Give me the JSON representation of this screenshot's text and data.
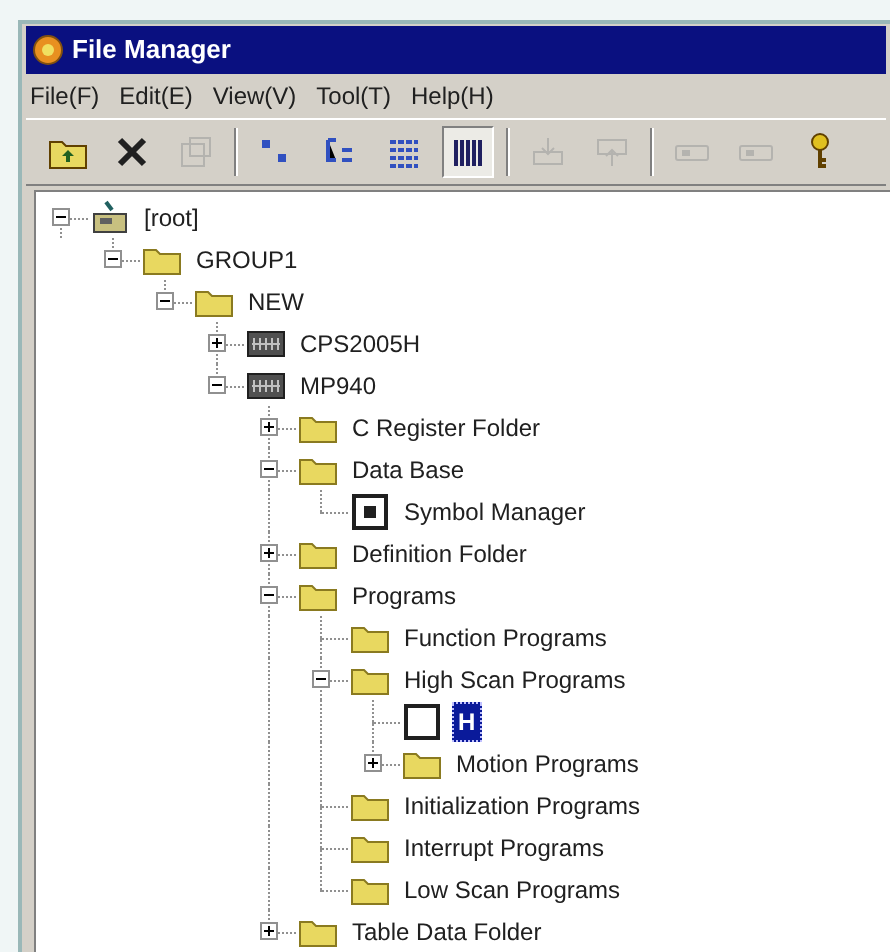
{
  "window": {
    "title": "File Manager"
  },
  "menu": [
    "File(F)",
    "Edit(E)",
    "View(V)",
    "Tool(T)",
    "Help(H)"
  ],
  "toolbar": [
    {
      "kind": "up-folder",
      "pressed": false,
      "disabled": false
    },
    {
      "kind": "delete",
      "pressed": false,
      "disabled": false
    },
    {
      "kind": "properties",
      "pressed": false,
      "disabled": true
    },
    {
      "kind": "sep"
    },
    {
      "kind": "large-icons",
      "pressed": false,
      "disabled": false
    },
    {
      "kind": "small-icons",
      "pressed": false,
      "disabled": false
    },
    {
      "kind": "list",
      "pressed": false,
      "disabled": false
    },
    {
      "kind": "details",
      "pressed": true,
      "disabled": false
    },
    {
      "kind": "sep"
    },
    {
      "kind": "import",
      "pressed": false,
      "disabled": true
    },
    {
      "kind": "export",
      "pressed": false,
      "disabled": true
    },
    {
      "kind": "sep"
    },
    {
      "kind": "device",
      "pressed": false,
      "disabled": true
    },
    {
      "kind": "device",
      "pressed": false,
      "disabled": true
    },
    {
      "kind": "key",
      "pressed": false,
      "disabled": false
    }
  ],
  "tree": [
    {
      "label": "[root]",
      "kind": "root",
      "expanded": true,
      "selected": false,
      "children": [
        {
          "label": "GROUP1",
          "kind": "folder",
          "expanded": true,
          "selected": false,
          "children": [
            {
              "label": "NEW",
              "kind": "folder",
              "expanded": true,
              "selected": false,
              "children": [
                {
                  "label": "CPS2005H",
                  "kind": "cpu",
                  "expanded": false,
                  "selected": false
                },
                {
                  "label": "MP940",
                  "kind": "cpu",
                  "expanded": true,
                  "selected": false,
                  "children": [
                    {
                      "label": "C Register Folder",
                      "kind": "folder",
                      "expanded": false,
                      "selected": false
                    },
                    {
                      "label": "Data Base",
                      "kind": "folder",
                      "expanded": true,
                      "selected": false,
                      "children": [
                        {
                          "label": "Symbol Manager",
                          "kind": "symbol",
                          "selected": false
                        }
                      ]
                    },
                    {
                      "label": "Definition Folder",
                      "kind": "folder",
                      "expanded": false,
                      "selected": false
                    },
                    {
                      "label": "Programs",
                      "kind": "folder",
                      "expanded": true,
                      "selected": false,
                      "children": [
                        {
                          "label": "Function Programs",
                          "kind": "folder",
                          "selected": false
                        },
                        {
                          "label": "High Scan Programs",
                          "kind": "folder",
                          "expanded": true,
                          "selected": false,
                          "children": [
                            {
                              "label": "H",
                              "kind": "blank",
                              "selected": true
                            },
                            {
                              "label": "Motion Programs",
                              "kind": "folder",
                              "expanded": false,
                              "selected": false
                            }
                          ]
                        },
                        {
                          "label": "Initialization Programs",
                          "kind": "folder",
                          "selected": false
                        },
                        {
                          "label": "Interrupt Programs",
                          "kind": "folder",
                          "selected": false
                        },
                        {
                          "label": "Low Scan Programs",
                          "kind": "folder",
                          "selected": false
                        }
                      ]
                    },
                    {
                      "label": "Table Data Folder",
                      "kind": "folder",
                      "expanded": false,
                      "selected": false
                    }
                  ]
                }
              ]
            }
          ]
        }
      ]
    }
  ]
}
